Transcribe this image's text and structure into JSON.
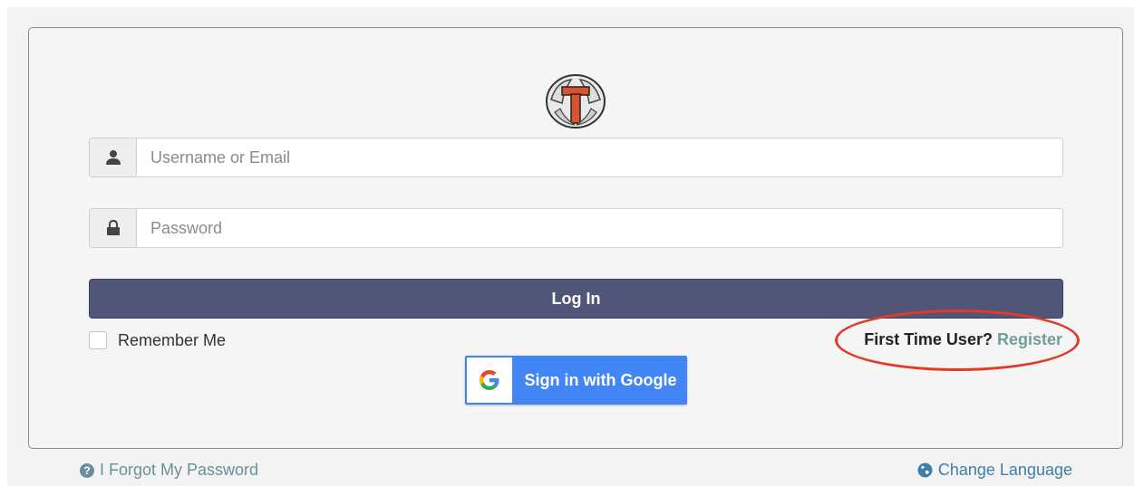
{
  "form": {
    "username_placeholder": "Username or Email",
    "password_placeholder": "Password",
    "login_label": "Log In",
    "remember_label": "Remember Me",
    "first_time_label": "First Time User?",
    "register_label": "Register",
    "google_label": "Sign in with Google"
  },
  "footer": {
    "forgot_label": "I Forgot My Password",
    "language_label": "Change Language"
  },
  "icons": {
    "user": "user-icon",
    "lock": "lock-icon",
    "google": "google-icon",
    "help": "question-circle-icon",
    "globe": "globe-icon",
    "logo": "school-logo"
  },
  "colors": {
    "login_button": "#515679",
    "google_button": "#4285f4",
    "register_link": "#6f9f9e",
    "highlight": "#e23b24"
  }
}
